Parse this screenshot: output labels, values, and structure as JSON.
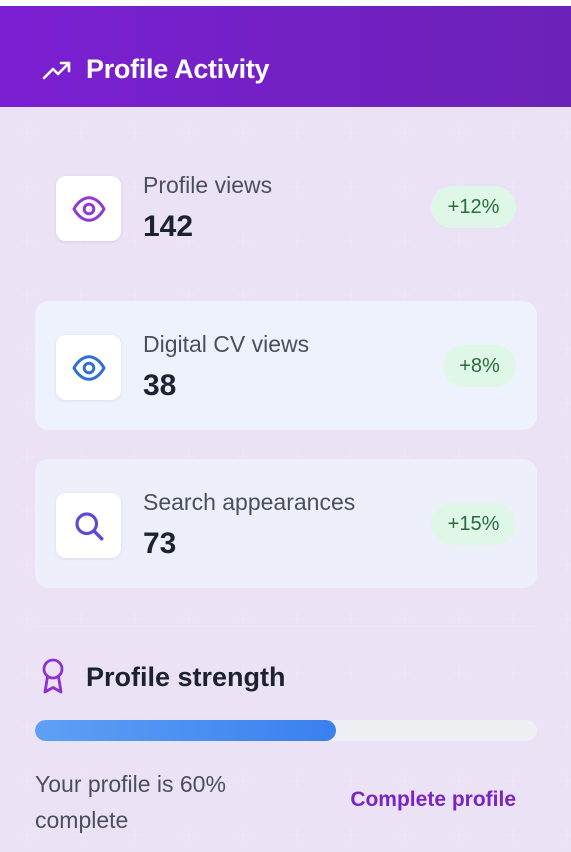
{
  "header": {
    "title": "Profile Activity",
    "icon": "trending-up-icon"
  },
  "stats": [
    {
      "label": "Profile views",
      "value": "142",
      "change": "+12%",
      "icon": "eye-icon",
      "icon_color": "#8e3bd6"
    },
    {
      "label": "Digital CV views",
      "value": "38",
      "change": "+8%",
      "icon": "eye-icon",
      "icon_color": "#2f6fd6"
    },
    {
      "label": "Search appearances",
      "value": "73",
      "change": "+15%",
      "icon": "search-icon",
      "icon_color": "#5b4bd6"
    }
  ],
  "strength": {
    "title": "Profile strength",
    "icon": "award-ribbon-icon",
    "progress_percent": 60,
    "progress_text": "Your profile is 60% complete",
    "action_label": "Complete profile"
  },
  "colors": {
    "header_start": "#7a1fd2",
    "header_end": "#6c22b8",
    "badge_bg": "#dff7e6",
    "badge_text": "#2a6b3e",
    "progress": "#3a80ee",
    "accent": "#7a24c8"
  }
}
